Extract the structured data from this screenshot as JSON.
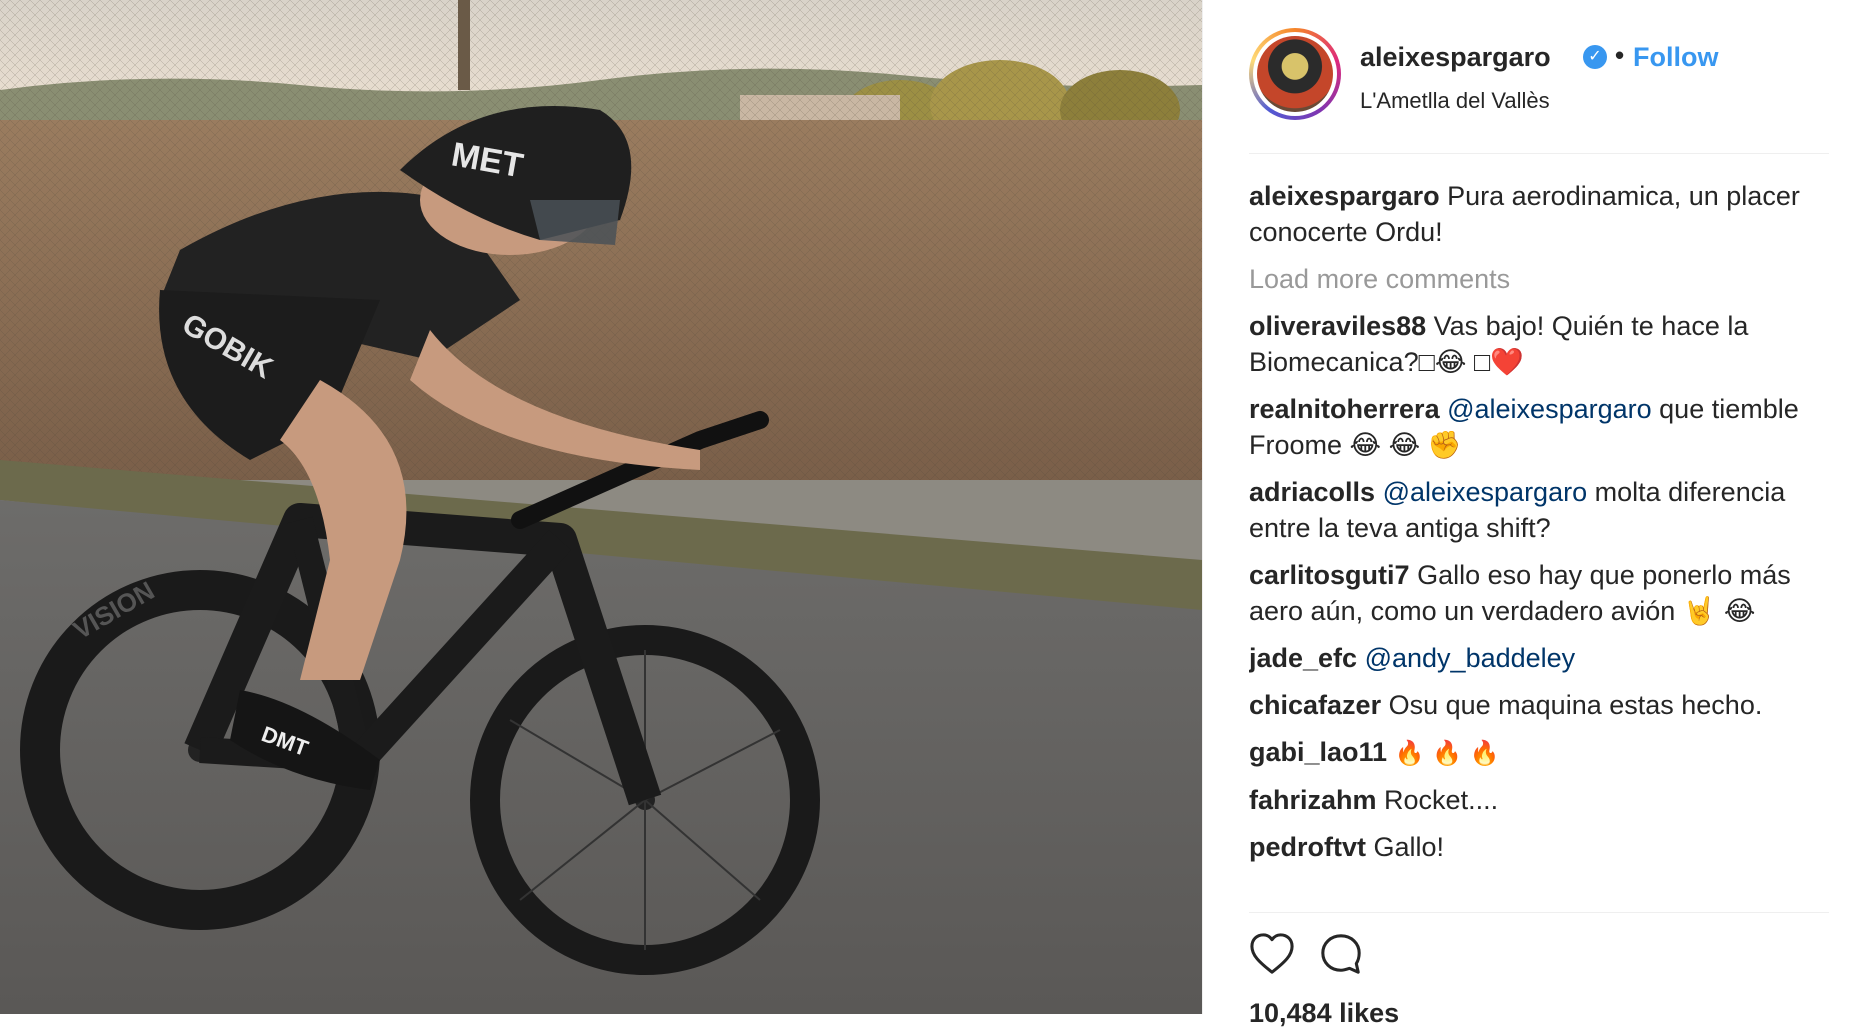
{
  "post": {
    "username": "aleixespargaro",
    "verified_icon": "verified-badge-icon",
    "separator": "•",
    "follow_label": "Follow",
    "location": "L'Ametlla del Vallès",
    "likes_text": "10,484 likes"
  },
  "photo": {
    "description_icon": "photo-cyclist-time-trial",
    "helmet_text": "MET",
    "jersey_text": "GOBIK",
    "wheel_text": "VISION",
    "shoe_text": "DMT"
  },
  "caption": {
    "username": "aleixespargaro",
    "text": "Pura aerodinamica, un placer conocerte Ordu!"
  },
  "load_more_label": "Load more comments",
  "comments": [
    {
      "user": "oliveraviles88",
      "mention": "",
      "text": "Vas bajo! Quién te hace la Biomecanica?□😂 □❤️"
    },
    {
      "user": "realnitoherrera",
      "mention": "@aleixespargaro",
      "text": "que tiemble Froome 😂 😂 ✊"
    },
    {
      "user": "adriacolls",
      "mention": "@aleixespargaro",
      "text": "molta diferencia entre la teva antiga shift?"
    },
    {
      "user": "carlitosguti7",
      "mention": "",
      "text": "Gallo eso hay que ponerlo más aero aún, como un verdadero avión 🤘 😂"
    },
    {
      "user": "jade_efc",
      "mention": "@andy_baddeley",
      "text": ""
    },
    {
      "user": "chicafazer",
      "mention": "",
      "text": "Osu que maquina estas hecho."
    },
    {
      "user": "gabi_lao11",
      "mention": "",
      "text": "🔥 🔥 🔥"
    },
    {
      "user": "fahrizahm",
      "mention": "",
      "text": "Rocket...."
    },
    {
      "user": "pedroftvt",
      "mention": "",
      "text": "Gallo!"
    }
  ],
  "actions": {
    "like_icon": "heart-icon",
    "comment_icon": "comment-bubble-icon"
  },
  "colors": {
    "link_blue": "#3897f0",
    "mention_blue": "#003569",
    "muted_gray": "#999999",
    "text_dark": "#262626"
  }
}
